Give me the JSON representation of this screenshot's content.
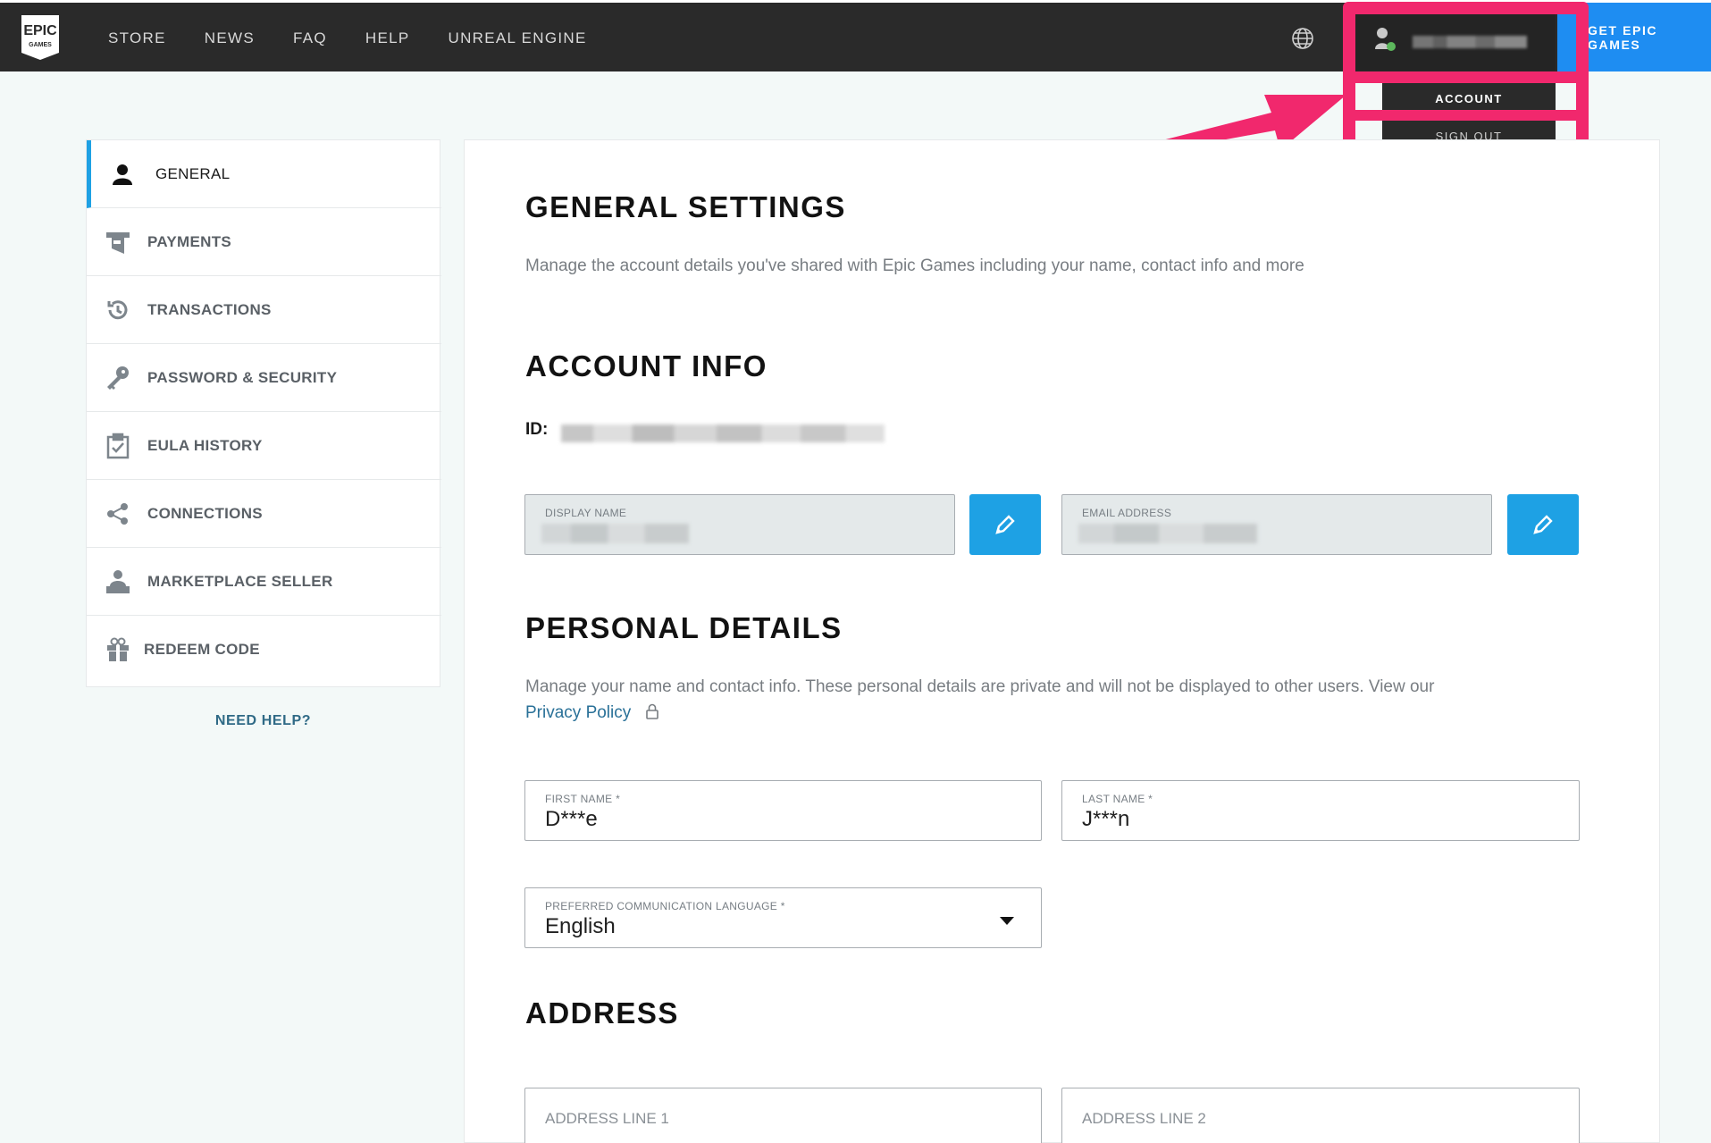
{
  "topnav": {
    "links": [
      "STORE",
      "NEWS",
      "FAQ",
      "HELP",
      "UNREAL ENGINE"
    ],
    "logo_text_top": "EPIC",
    "logo_text_bottom": "GAMES",
    "get_epic_label": "GET EPIC GAMES",
    "icons": [
      "globe-icon",
      "user-avatar-icon"
    ]
  },
  "dropdown": {
    "account_label": "ACCOUNT",
    "signout_label": "SIGN OUT"
  },
  "sidebar": {
    "items": [
      {
        "label": "GENERAL",
        "icon": "person-icon"
      },
      {
        "label": "PAYMENTS",
        "icon": "wallet-icon"
      },
      {
        "label": "TRANSACTIONS",
        "icon": "history-icon"
      },
      {
        "label": "PASSWORD & SECURITY",
        "icon": "key-icon"
      },
      {
        "label": "EULA HISTORY",
        "icon": "clipboard-check-icon"
      },
      {
        "label": "CONNECTIONS",
        "icon": "share-icon"
      },
      {
        "label": "MARKETPLACE SELLER",
        "icon": "seller-icon"
      },
      {
        "label": "REDEEM CODE",
        "icon": "gift-icon"
      }
    ],
    "active_index": 0,
    "need_help": "NEED HELP?"
  },
  "main": {
    "general_title": "GENERAL SETTINGS",
    "general_desc": "Manage the account details you've shared with Epic Games including your name, contact info and more",
    "account_title": "ACCOUNT INFO",
    "id_label": "ID:",
    "display_name_label": "DISPLAY NAME",
    "email_label": "EMAIL ADDRESS",
    "personal_title": "PERSONAL DETAILS",
    "personal_desc": "Manage your name and contact info. These personal details are private and will not be displayed to other users. View our",
    "privacy_link": "Privacy Policy",
    "first_name_label": "FIRST NAME *",
    "first_name_value": "D***e",
    "last_name_label": "LAST NAME *",
    "last_name_value": "J***n",
    "language_label": "PREFERRED COMMUNICATION LANGUAGE *",
    "language_value": "English",
    "address_title": "ADDRESS",
    "address_line1_placeholder": "ADDRESS LINE 1",
    "address_line2_placeholder": "ADDRESS LINE 2"
  },
  "colors": {
    "nav_bg": "#2a2a2a",
    "accent_blue": "#1ea1e4",
    "highlight_pink": "#f1286d",
    "page_bg": "#f3f9f8"
  }
}
